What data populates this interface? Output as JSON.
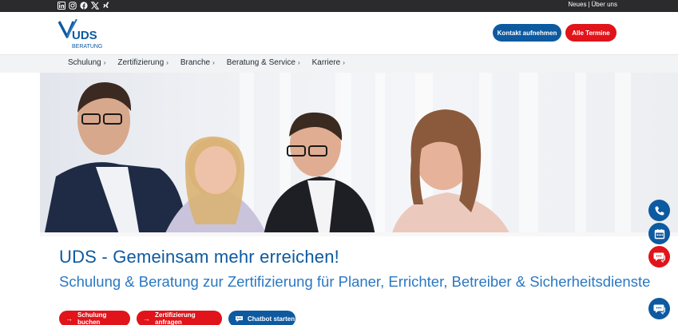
{
  "topbar": {
    "social_icons": [
      "linkedin-icon",
      "instagram-icon",
      "facebook-icon",
      "x-icon",
      "xing-icon"
    ],
    "links": [
      {
        "label": "Neues"
      },
      {
        "label": "Über uns"
      }
    ],
    "separator": "|"
  },
  "header": {
    "logo": {
      "text": "UDS",
      "subtext": "BERATUNG"
    },
    "contact_button": "Kontakt aufnehmen",
    "termine_button": "Alle Termine"
  },
  "nav": {
    "items": [
      {
        "label": "Schulung"
      },
      {
        "label": "Zertifizierung"
      },
      {
        "label": "Branche"
      },
      {
        "label": "Beratung & Service"
      },
      {
        "label": "Karriere"
      }
    ],
    "chevron": "›"
  },
  "hero": {
    "headline": "UDS - Gemeinsam mehr erreichen!",
    "subheadline": "Schulung & Beratung zur Zertifizierung für Planer, Errichter, Betreiber & Sicherheitsdienste"
  },
  "cta": {
    "schulung": "Schulung buchen",
    "zertifizierung": "Zertifizierung anfragen",
    "chatbot": "Chatbot starten",
    "arrow": "→"
  },
  "floating": {
    "icons": [
      "phone-icon",
      "calendar-icon",
      "chat-icon",
      "chat-icon"
    ]
  },
  "colors": {
    "brand_blue": "#0d5aa1",
    "accent_red": "#e0141a",
    "topbar": "#2b2b2e",
    "headline_blue": "#0d5aa1",
    "subheadline_blue": "#2a78c2"
  }
}
